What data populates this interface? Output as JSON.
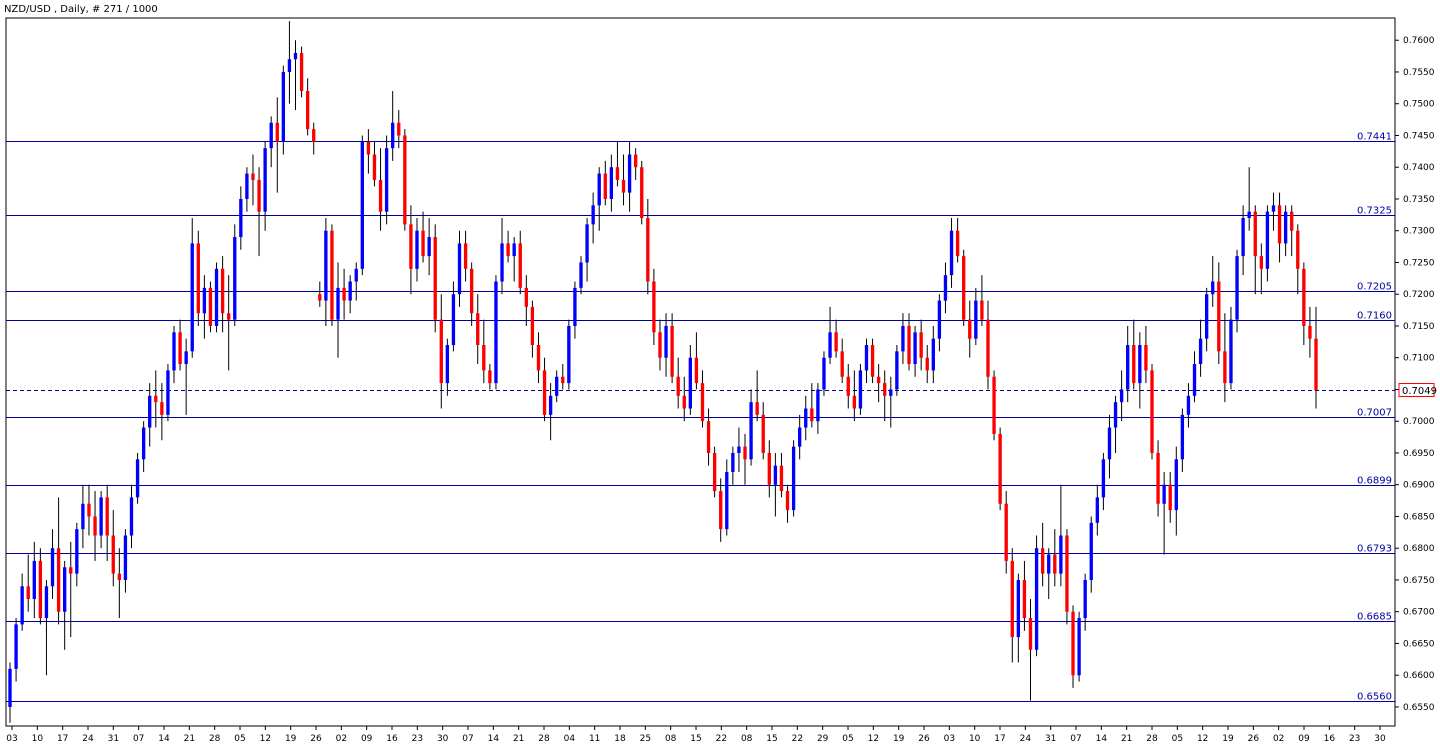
{
  "window": {
    "title": "NZD/USD , Daily, # 271 / 1000"
  },
  "colors": {
    "background": "#ffffff",
    "axis": "#000000",
    "bull": "#0000ff",
    "bear": "#ff0000",
    "level_line": "#0000a0",
    "current_line": "#0000a0",
    "price_tag_border": "#ff0000"
  },
  "chart_data": {
    "type": "candlestick",
    "title": "NZD/USD , Daily, # 271 / 1000",
    "ylim": [
      0.652,
      0.7635
    ],
    "y_ticks": [
      "0.7600",
      "0.7550",
      "0.7500",
      "0.7450",
      "0.7400",
      "0.7350",
      "0.7300",
      "0.7250",
      "0.7200",
      "0.7150",
      "0.7100",
      "0.7050",
      "0.7000",
      "0.6950",
      "0.6900",
      "0.6850",
      "0.6800",
      "0.6750",
      "0.6700",
      "0.6650",
      "0.6600",
      "0.6550"
    ],
    "x_ticks": [
      "03",
      "10",
      "17",
      "24",
      "31",
      "07",
      "14",
      "21",
      "28",
      "05",
      "12",
      "19",
      "26",
      "02",
      "09",
      "16",
      "23",
      "30",
      "07",
      "14",
      "21",
      "28",
      "04",
      "11",
      "18",
      "25",
      "08",
      "15",
      "22",
      "08",
      "15",
      "22",
      "29",
      "05",
      "12",
      "19",
      "26",
      "03",
      "10",
      "17",
      "24",
      "31",
      "07",
      "14",
      "21",
      "28",
      "05",
      "12",
      "19",
      "26",
      "02",
      "09",
      "16",
      "23",
      "30"
    ],
    "levels": [
      {
        "label": "0.7441",
        "value": 0.7441
      },
      {
        "label": "0.7325",
        "value": 0.7325
      },
      {
        "label": "0.7205",
        "value": 0.7205
      },
      {
        "label": "0.7160",
        "value": 0.716
      },
      {
        "label": "0.7007",
        "value": 0.7007
      },
      {
        "label": "0.6899",
        "value": 0.6899
      },
      {
        "label": "0.6793",
        "value": 0.6793
      },
      {
        "label": "0.6685",
        "value": 0.6685
      },
      {
        "label": "0.6560",
        "value": 0.656
      }
    ],
    "current_price": {
      "label": "0.7049",
      "value": 0.7049
    },
    "ohlc": [
      [
        0.655,
        0.662,
        0.6525,
        0.661
      ],
      [
        0.661,
        0.669,
        0.659,
        0.668
      ],
      [
        0.668,
        0.676,
        0.667,
        0.674
      ],
      [
        0.674,
        0.679,
        0.67,
        0.672
      ],
      [
        0.672,
        0.681,
        0.669,
        0.678
      ],
      [
        0.678,
        0.68,
        0.668,
        0.669
      ],
      [
        0.669,
        0.675,
        0.66,
        0.674
      ],
      [
        0.674,
        0.683,
        0.672,
        0.68
      ],
      [
        0.68,
        0.688,
        0.668,
        0.67
      ],
      [
        0.67,
        0.678,
        0.664,
        0.677
      ],
      [
        0.677,
        0.681,
        0.666,
        0.676
      ],
      [
        0.676,
        0.684,
        0.674,
        0.683
      ],
      [
        0.683,
        0.69,
        0.68,
        0.687
      ],
      [
        0.687,
        0.69,
        0.682,
        0.685
      ],
      [
        0.685,
        0.689,
        0.678,
        0.682
      ],
      [
        0.682,
        0.689,
        0.68,
        0.688
      ],
      [
        0.688,
        0.69,
        0.678,
        0.682
      ],
      [
        0.682,
        0.686,
        0.674,
        0.676
      ],
      [
        0.676,
        0.68,
        0.669,
        0.675
      ],
      [
        0.675,
        0.683,
        0.673,
        0.682
      ],
      [
        0.682,
        0.69,
        0.68,
        0.688
      ],
      [
        0.688,
        0.695,
        0.687,
        0.694
      ],
      [
        0.694,
        0.7,
        0.692,
        0.699
      ],
      [
        0.699,
        0.706,
        0.696,
        0.704
      ],
      [
        0.704,
        0.708,
        0.699,
        0.703
      ],
      [
        0.703,
        0.706,
        0.697,
        0.701
      ],
      [
        0.701,
        0.709,
        0.7,
        0.708
      ],
      [
        0.708,
        0.715,
        0.706,
        0.714
      ],
      [
        0.714,
        0.716,
        0.708,
        0.709
      ],
      [
        0.709,
        0.713,
        0.701,
        0.711
      ],
      [
        0.711,
        0.732,
        0.71,
        0.728
      ],
      [
        0.728,
        0.73,
        0.715,
        0.717
      ],
      [
        0.717,
        0.723,
        0.713,
        0.721
      ],
      [
        0.721,
        0.722,
        0.714,
        0.715
      ],
      [
        0.715,
        0.725,
        0.714,
        0.724
      ],
      [
        0.724,
        0.726,
        0.714,
        0.717
      ],
      [
        0.717,
        0.723,
        0.708,
        0.716
      ],
      [
        0.716,
        0.731,
        0.715,
        0.729
      ],
      [
        0.729,
        0.737,
        0.727,
        0.735
      ],
      [
        0.735,
        0.74,
        0.733,
        0.739
      ],
      [
        0.739,
        0.742,
        0.734,
        0.738
      ],
      [
        0.738,
        0.74,
        0.726,
        0.733
      ],
      [
        0.733,
        0.744,
        0.73,
        0.743
      ],
      [
        0.743,
        0.748,
        0.74,
        0.747
      ],
      [
        0.747,
        0.751,
        0.736,
        0.744
      ],
      [
        0.744,
        0.756,
        0.742,
        0.755
      ],
      [
        0.755,
        0.763,
        0.75,
        0.757
      ],
      [
        0.757,
        0.76,
        0.749,
        0.758
      ],
      [
        0.758,
        0.759,
        0.751,
        0.752
      ],
      [
        0.752,
        0.754,
        0.745,
        0.746
      ],
      [
        0.746,
        0.747,
        0.742,
        0.744
      ],
      [
        0.72,
        0.722,
        0.718,
        0.719
      ],
      [
        0.719,
        0.732,
        0.715,
        0.73
      ],
      [
        0.73,
        0.731,
        0.715,
        0.716
      ],
      [
        0.716,
        0.725,
        0.71,
        0.721
      ],
      [
        0.721,
        0.724,
        0.716,
        0.719
      ],
      [
        0.719,
        0.723,
        0.717,
        0.722
      ],
      [
        0.722,
        0.725,
        0.719,
        0.724
      ],
      [
        0.724,
        0.745,
        0.723,
        0.744
      ],
      [
        0.744,
        0.746,
        0.739,
        0.742
      ],
      [
        0.742,
        0.744,
        0.737,
        0.738
      ],
      [
        0.738,
        0.743,
        0.73,
        0.733
      ],
      [
        0.733,
        0.745,
        0.731,
        0.743
      ],
      [
        0.743,
        0.752,
        0.741,
        0.747
      ],
      [
        0.747,
        0.749,
        0.743,
        0.745
      ],
      [
        0.745,
        0.746,
        0.73,
        0.731
      ],
      [
        0.731,
        0.734,
        0.72,
        0.724
      ],
      [
        0.724,
        0.732,
        0.722,
        0.73
      ],
      [
        0.73,
        0.733,
        0.725,
        0.726
      ],
      [
        0.726,
        0.732,
        0.723,
        0.729
      ],
      [
        0.729,
        0.731,
        0.714,
        0.716
      ],
      [
        0.716,
        0.72,
        0.702,
        0.706
      ],
      [
        0.706,
        0.713,
        0.704,
        0.712
      ],
      [
        0.712,
        0.722,
        0.711,
        0.72
      ],
      [
        0.72,
        0.73,
        0.718,
        0.728
      ],
      [
        0.728,
        0.73,
        0.722,
        0.724
      ],
      [
        0.724,
        0.725,
        0.715,
        0.717
      ],
      [
        0.717,
        0.72,
        0.709,
        0.712
      ],
      [
        0.712,
        0.716,
        0.706,
        0.708
      ],
      [
        0.708,
        0.709,
        0.705,
        0.706
      ],
      [
        0.706,
        0.723,
        0.705,
        0.722
      ],
      [
        0.722,
        0.732,
        0.72,
        0.728
      ],
      [
        0.728,
        0.73,
        0.725,
        0.726
      ],
      [
        0.726,
        0.729,
        0.722,
        0.728
      ],
      [
        0.728,
        0.73,
        0.72,
        0.721
      ],
      [
        0.721,
        0.723,
        0.715,
        0.718
      ],
      [
        0.718,
        0.719,
        0.71,
        0.712
      ],
      [
        0.712,
        0.714,
        0.706,
        0.708
      ],
      [
        0.708,
        0.71,
        0.7,
        0.701
      ],
      [
        0.701,
        0.706,
        0.697,
        0.704
      ],
      [
        0.704,
        0.708,
        0.703,
        0.707
      ],
      [
        0.707,
        0.709,
        0.705,
        0.706
      ],
      [
        0.706,
        0.716,
        0.705,
        0.715
      ],
      [
        0.715,
        0.722,
        0.713,
        0.721
      ],
      [
        0.721,
        0.726,
        0.72,
        0.725
      ],
      [
        0.725,
        0.732,
        0.722,
        0.731
      ],
      [
        0.731,
        0.736,
        0.728,
        0.734
      ],
      [
        0.734,
        0.74,
        0.73,
        0.739
      ],
      [
        0.739,
        0.741,
        0.734,
        0.735
      ],
      [
        0.735,
        0.742,
        0.733,
        0.74
      ],
      [
        0.74,
        0.744,
        0.737,
        0.738
      ],
      [
        0.738,
        0.742,
        0.734,
        0.736
      ],
      [
        0.736,
        0.744,
        0.733,
        0.742
      ],
      [
        0.742,
        0.743,
        0.738,
        0.74
      ],
      [
        0.74,
        0.741,
        0.731,
        0.732
      ],
      [
        0.732,
        0.735,
        0.72,
        0.722
      ],
      [
        0.722,
        0.724,
        0.712,
        0.714
      ],
      [
        0.714,
        0.716,
        0.708,
        0.71
      ],
      [
        0.71,
        0.717,
        0.707,
        0.715
      ],
      [
        0.715,
        0.717,
        0.706,
        0.707
      ],
      [
        0.707,
        0.71,
        0.702,
        0.704
      ],
      [
        0.704,
        0.707,
        0.7,
        0.702
      ],
      [
        0.702,
        0.712,
        0.701,
        0.71
      ],
      [
        0.71,
        0.714,
        0.705,
        0.706
      ],
      [
        0.706,
        0.708,
        0.699,
        0.7
      ],
      [
        0.7,
        0.702,
        0.693,
        0.695
      ],
      [
        0.695,
        0.696,
        0.688,
        0.689
      ],
      [
        0.689,
        0.691,
        0.681,
        0.683
      ],
      [
        0.683,
        0.694,
        0.682,
        0.692
      ],
      [
        0.692,
        0.696,
        0.69,
        0.695
      ],
      [
        0.695,
        0.699,
        0.692,
        0.696
      ],
      [
        0.696,
        0.698,
        0.69,
        0.694
      ],
      [
        0.694,
        0.705,
        0.693,
        0.703
      ],
      [
        0.703,
        0.708,
        0.7,
        0.701
      ],
      [
        0.701,
        0.703,
        0.694,
        0.695
      ],
      [
        0.695,
        0.697,
        0.688,
        0.69
      ],
      [
        0.69,
        0.695,
        0.685,
        0.693
      ],
      [
        0.693,
        0.695,
        0.688,
        0.689
      ],
      [
        0.689,
        0.69,
        0.684,
        0.686
      ],
      [
        0.686,
        0.697,
        0.685,
        0.696
      ],
      [
        0.696,
        0.701,
        0.694,
        0.699
      ],
      [
        0.699,
        0.704,
        0.697,
        0.702
      ],
      [
        0.702,
        0.706,
        0.699,
        0.7
      ],
      [
        0.7,
        0.706,
        0.698,
        0.705
      ],
      [
        0.705,
        0.711,
        0.704,
        0.71
      ],
      [
        0.71,
        0.718,
        0.709,
        0.714
      ],
      [
        0.714,
        0.716,
        0.71,
        0.711
      ],
      [
        0.711,
        0.713,
        0.706,
        0.707
      ],
      [
        0.707,
        0.709,
        0.702,
        0.704
      ],
      [
        0.704,
        0.708,
        0.7,
        0.702
      ],
      [
        0.702,
        0.709,
        0.701,
        0.708
      ],
      [
        0.708,
        0.713,
        0.706,
        0.712
      ],
      [
        0.712,
        0.713,
        0.706,
        0.707
      ],
      [
        0.707,
        0.709,
        0.703,
        0.706
      ],
      [
        0.706,
        0.708,
        0.7,
        0.704
      ],
      [
        0.704,
        0.707,
        0.699,
        0.705
      ],
      [
        0.705,
        0.712,
        0.704,
        0.711
      ],
      [
        0.711,
        0.717,
        0.709,
        0.715
      ],
      [
        0.715,
        0.717,
        0.708,
        0.709
      ],
      [
        0.709,
        0.715,
        0.707,
        0.714
      ],
      [
        0.714,
        0.716,
        0.708,
        0.71
      ],
      [
        0.71,
        0.712,
        0.706,
        0.708
      ],
      [
        0.708,
        0.715,
        0.706,
        0.713
      ],
      [
        0.713,
        0.72,
        0.711,
        0.719
      ],
      [
        0.719,
        0.725,
        0.717,
        0.723
      ],
      [
        0.723,
        0.732,
        0.721,
        0.73
      ],
      [
        0.73,
        0.732,
        0.725,
        0.726
      ],
      [
        0.726,
        0.727,
        0.715,
        0.716
      ],
      [
        0.716,
        0.719,
        0.71,
        0.713
      ],
      [
        0.713,
        0.721,
        0.712,
        0.719
      ],
      [
        0.719,
        0.723,
        0.715,
        0.716
      ],
      [
        0.716,
        0.719,
        0.705,
        0.707
      ],
      [
        0.707,
        0.708,
        0.697,
        0.698
      ],
      [
        0.698,
        0.699,
        0.686,
        0.687
      ],
      [
        0.687,
        0.689,
        0.676,
        0.678
      ],
      [
        0.678,
        0.68,
        0.662,
        0.666
      ],
      [
        0.666,
        0.676,
        0.662,
        0.675
      ],
      [
        0.675,
        0.678,
        0.667,
        0.669
      ],
      [
        0.669,
        0.672,
        0.656,
        0.664
      ],
      [
        0.664,
        0.682,
        0.663,
        0.68
      ],
      [
        0.68,
        0.684,
        0.674,
        0.676
      ],
      [
        0.676,
        0.68,
        0.672,
        0.679
      ],
      [
        0.679,
        0.683,
        0.674,
        0.676
      ],
      [
        0.676,
        0.69,
        0.674,
        0.682
      ],
      [
        0.682,
        0.683,
        0.668,
        0.67
      ],
      [
        0.67,
        0.671,
        0.658,
        0.66
      ],
      [
        0.66,
        0.67,
        0.659,
        0.669
      ],
      [
        0.669,
        0.676,
        0.667,
        0.675
      ],
      [
        0.675,
        0.685,
        0.673,
        0.684
      ],
      [
        0.684,
        0.69,
        0.682,
        0.688
      ],
      [
        0.688,
        0.695,
        0.686,
        0.694
      ],
      [
        0.694,
        0.701,
        0.691,
        0.699
      ],
      [
        0.699,
        0.704,
        0.695,
        0.703
      ],
      [
        0.703,
        0.708,
        0.7,
        0.705
      ],
      [
        0.705,
        0.715,
        0.703,
        0.712
      ],
      [
        0.712,
        0.716,
        0.705,
        0.706
      ],
      [
        0.706,
        0.714,
        0.702,
        0.712
      ],
      [
        0.712,
        0.715,
        0.706,
        0.708
      ],
      [
        0.708,
        0.709,
        0.694,
        0.695
      ],
      [
        0.695,
        0.697,
        0.685,
        0.687
      ],
      [
        0.687,
        0.692,
        0.679,
        0.69
      ],
      [
        0.69,
        0.692,
        0.684,
        0.686
      ],
      [
        0.686,
        0.696,
        0.682,
        0.694
      ],
      [
        0.694,
        0.702,
        0.692,
        0.701
      ],
      [
        0.701,
        0.706,
        0.699,
        0.704
      ],
      [
        0.704,
        0.711,
        0.703,
        0.709
      ],
      [
        0.709,
        0.716,
        0.707,
        0.713
      ],
      [
        0.713,
        0.721,
        0.711,
        0.72
      ],
      [
        0.72,
        0.726,
        0.718,
        0.722
      ],
      [
        0.722,
        0.725,
        0.709,
        0.711
      ],
      [
        0.711,
        0.717,
        0.703,
        0.706
      ],
      [
        0.706,
        0.718,
        0.705,
        0.716
      ],
      [
        0.716,
        0.727,
        0.714,
        0.726
      ],
      [
        0.726,
        0.734,
        0.723,
        0.732
      ],
      [
        0.732,
        0.74,
        0.73,
        0.733
      ],
      [
        0.733,
        0.734,
        0.72,
        0.726
      ],
      [
        0.726,
        0.728,
        0.72,
        0.724
      ],
      [
        0.724,
        0.734,
        0.722,
        0.733
      ],
      [
        0.733,
        0.736,
        0.73,
        0.734
      ],
      [
        0.734,
        0.736,
        0.725,
        0.728
      ],
      [
        0.728,
        0.734,
        0.726,
        0.733
      ],
      [
        0.733,
        0.734,
        0.726,
        0.73
      ],
      [
        0.73,
        0.731,
        0.72,
        0.724
      ],
      [
        0.724,
        0.725,
        0.712,
        0.715
      ],
      [
        0.715,
        0.718,
        0.71,
        0.713
      ],
      [
        0.713,
        0.718,
        0.702,
        0.7049
      ]
    ]
  }
}
